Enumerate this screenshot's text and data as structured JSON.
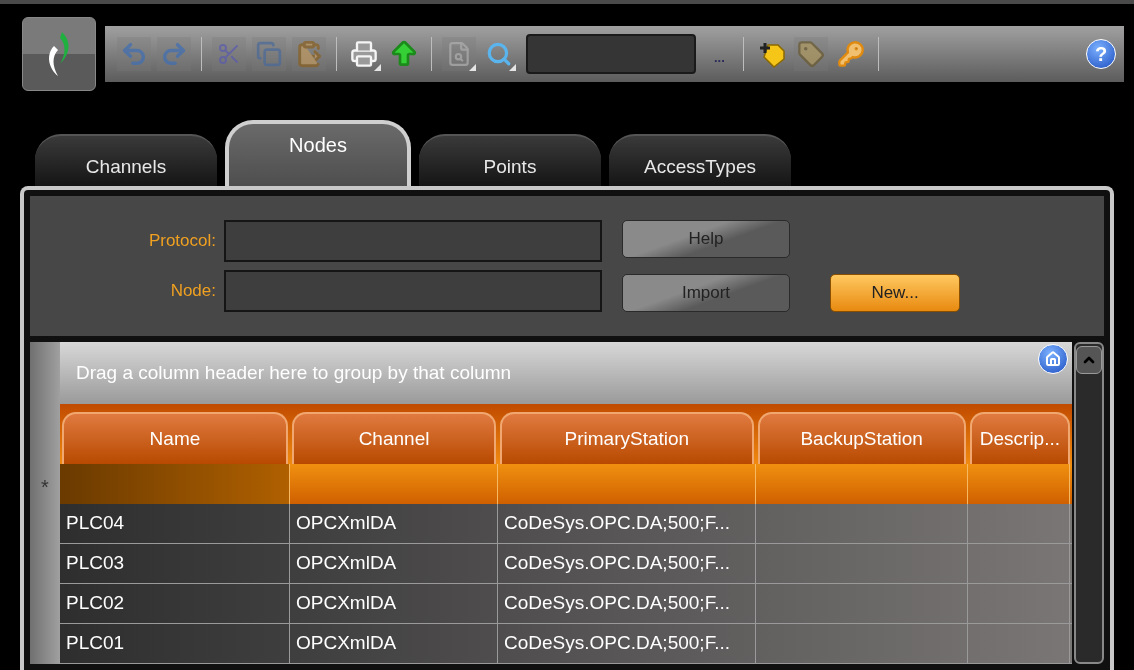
{
  "toolbar": {
    "items": [
      {
        "kind": "undo",
        "disabled": true
      },
      {
        "kind": "redo",
        "disabled": true
      },
      {
        "kind": "separator"
      },
      {
        "kind": "cut",
        "disabled": true
      },
      {
        "kind": "copy",
        "disabled": true
      },
      {
        "kind": "paste",
        "disabled": true
      },
      {
        "kind": "separator"
      },
      {
        "kind": "print",
        "disabled": false
      },
      {
        "kind": "upload",
        "disabled": false
      },
      {
        "kind": "separator"
      },
      {
        "kind": "preview",
        "disabled": true
      },
      {
        "kind": "search",
        "disabled": false
      },
      {
        "kind": "field"
      },
      {
        "kind": "ellipsis",
        "disabled": false,
        "label": "..."
      },
      {
        "kind": "separator"
      },
      {
        "kind": "tag_add",
        "disabled": false
      },
      {
        "kind": "tag",
        "disabled": true
      },
      {
        "kind": "keys",
        "disabled": false
      },
      {
        "kind": "separator"
      }
    ],
    "help_label": "?"
  },
  "tabs": [
    {
      "label": "Channels",
      "selected": false
    },
    {
      "label": "Nodes",
      "selected": true
    },
    {
      "label": "Points",
      "selected": false
    },
    {
      "label": "AccessTypes",
      "selected": false
    }
  ],
  "form": {
    "fields": [
      {
        "label": "Protocol:"
      },
      {
        "label": "Node:"
      }
    ],
    "buttons": [
      {
        "label": "Help",
        "kind": "plain"
      },
      {
        "label": "Import",
        "kind": "plain"
      },
      {
        "label": "New...",
        "kind": "accent"
      }
    ]
  },
  "grid": {
    "group_panel": "Drag a column header here to group by that column",
    "columns": [
      "Name",
      "Channel",
      "PrimaryStation",
      "BackupStation",
      "Descrip..."
    ],
    "new_row_marker": "*",
    "rows": [
      [
        "PLC04",
        "OPCXmlDA",
        "CoDeSys.OPC.DA;500;F...",
        "",
        ""
      ],
      [
        "PLC03",
        "OPCXmlDA",
        "CoDeSys.OPC.DA;500;F...",
        "",
        ""
      ],
      [
        "PLC02",
        "OPCXmlDA",
        "CoDeSys.OPC.DA;500;F...",
        "",
        ""
      ],
      [
        "PLC01",
        "OPCXmlDA",
        "CoDeSys.OPC.DA;500;F...",
        "",
        ""
      ]
    ]
  }
}
